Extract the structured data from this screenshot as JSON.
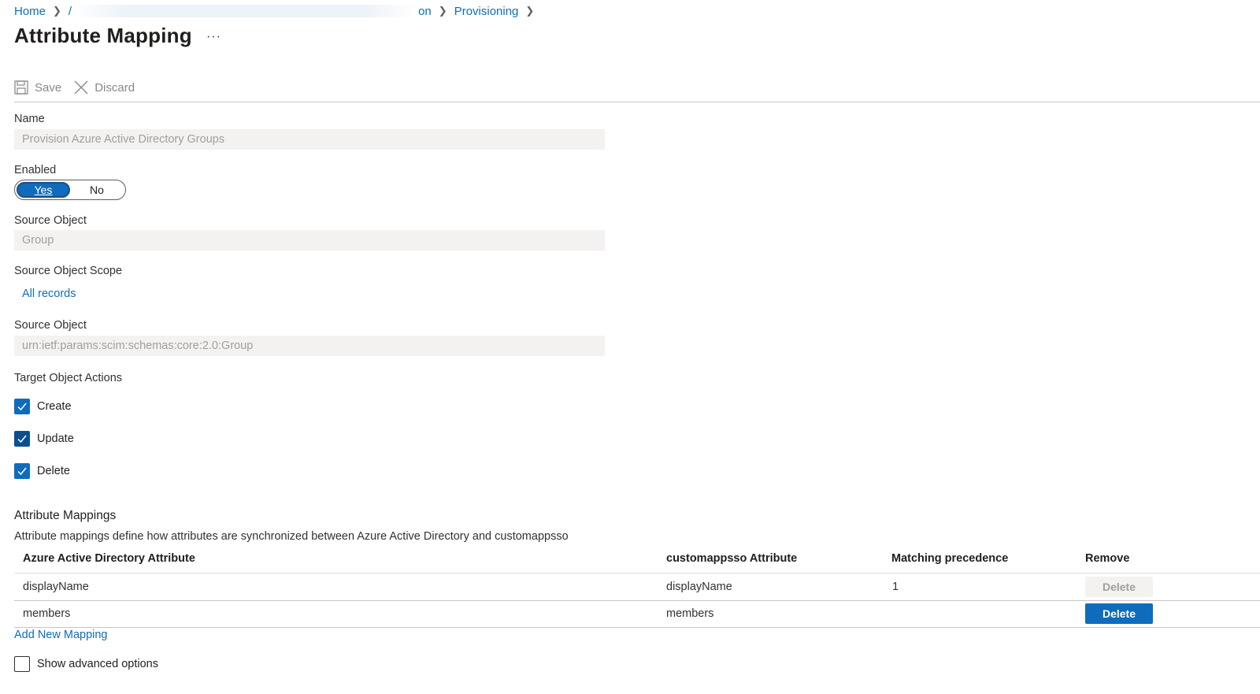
{
  "breadcrumb": {
    "home": "Home",
    "partial_left": "/",
    "partial_right": "on",
    "provisioning": "Provisioning"
  },
  "page": {
    "title": "Attribute Mapping",
    "more": "···"
  },
  "toolbar": {
    "save_label": "Save",
    "discard_label": "Discard"
  },
  "form": {
    "name_label": "Name",
    "name_value": "Provision Azure Active Directory Groups",
    "enabled_label": "Enabled",
    "enabled_yes": "Yes",
    "enabled_no": "No",
    "enabled_value": "Yes",
    "source_object_label": "Source Object",
    "source_object_value": "Group",
    "source_scope_label": "Source Object Scope",
    "source_scope_link": "All records",
    "target_object_label": "Source Object",
    "target_object_value": "urn:ietf:params:scim:schemas:core:2.0:Group",
    "target_actions_label": "Target Object Actions",
    "actions": [
      {
        "label": "Create",
        "checked": true
      },
      {
        "label": "Update",
        "checked": true
      },
      {
        "label": "Delete",
        "checked": true
      }
    ]
  },
  "mappings": {
    "title": "Attribute Mappings",
    "description": "Attribute mappings define how attributes are synchronized between Azure Active Directory and customappsso",
    "columns": [
      "Azure Active Directory Attribute",
      "customappsso Attribute",
      "Matching precedence",
      "Remove"
    ],
    "rows": [
      {
        "source": "displayName",
        "target": "displayName",
        "precedence": "1",
        "remove": "Delete",
        "remove_state": "disabled"
      },
      {
        "source": "members",
        "target": "members",
        "precedence": "",
        "remove": "Delete",
        "remove_state": "primary"
      }
    ],
    "add_link": "Add New Mapping"
  },
  "advanced": {
    "label": "Show advanced options",
    "checked": false
  },
  "colors": {
    "accent": "#0f6cbd",
    "disabled_text": "#a19f9d",
    "field_bg": "#f3f2f1"
  }
}
